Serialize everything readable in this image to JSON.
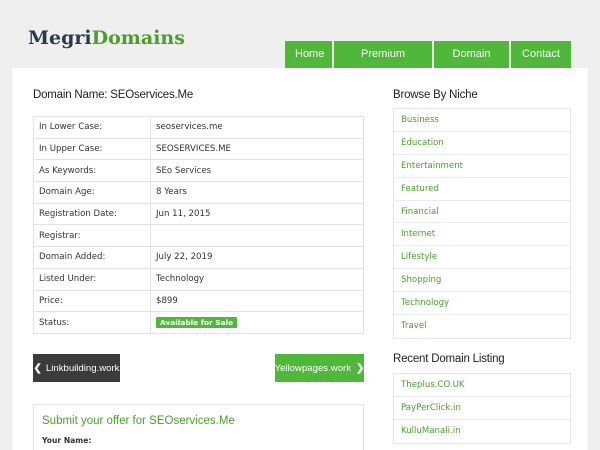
{
  "logo": {
    "part1": "Megri",
    "part2": "Domains"
  },
  "nav": [
    "Home",
    "Premium Domains",
    "Domain Sale",
    "Contact"
  ],
  "domain": {
    "heading": "Domain Name: SEOservices.Me",
    "rows": [
      {
        "k": "In Lower Case:",
        "v": "seoservices.me"
      },
      {
        "k": "In Upper Case:",
        "v": "SEOSERVICES.ME"
      },
      {
        "k": "As Keywords:",
        "v": "SEo Services"
      },
      {
        "k": "Domain Age:",
        "v": "8 Years"
      },
      {
        "k": "Registration Date:",
        "v": "Jun 11, 2015"
      },
      {
        "k": "Registrar:",
        "v": ""
      },
      {
        "k": "Domain Added:",
        "v": "July 22, 2019"
      },
      {
        "k": "Listed Under:",
        "v": "Technology"
      },
      {
        "k": "Price:",
        "v": "$899"
      },
      {
        "k": "Status:",
        "v": "Available for Sale"
      }
    ]
  },
  "pager": {
    "prev": "Linkbuilding.work",
    "next": "Yellowpages.work"
  },
  "offer": {
    "title": "Submit your offer for SEOservices.Me",
    "name_label": "Your Name:"
  },
  "browse": {
    "title": "Browse By Niche",
    "items": [
      "Business",
      "Education",
      "Entertainment",
      "Featured",
      "Financial",
      "Internet",
      "Lifestyle",
      "Shopping",
      "Technology",
      "Travel"
    ]
  },
  "recent": {
    "title": "Recent Domain Listing",
    "items": [
      "Theplus.CO.UK",
      "PayPerClick.in",
      "KulluManali.in"
    ]
  },
  "colors": {
    "accent": "#4fb83a",
    "dark": "#3b3b3b"
  }
}
